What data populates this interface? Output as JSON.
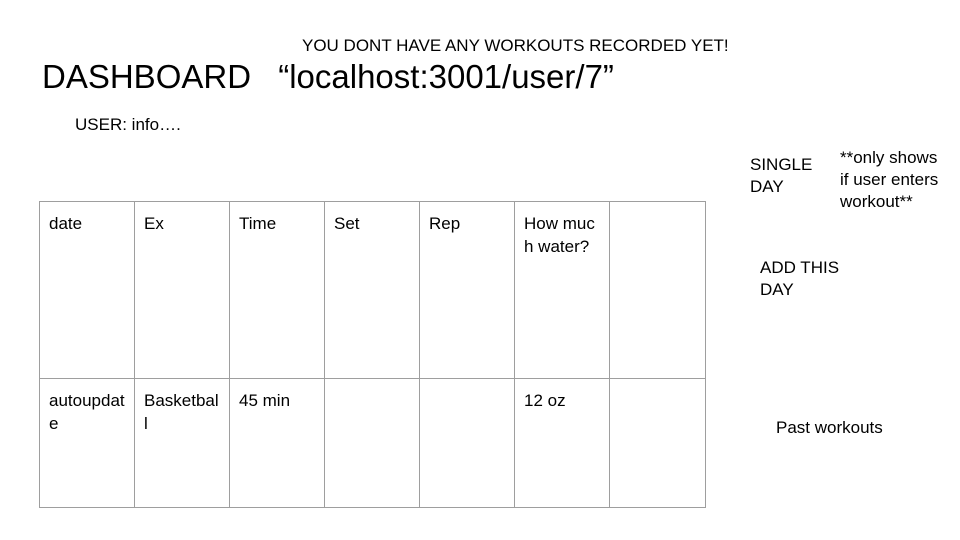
{
  "banner": "YOU DONT HAVE ANY WORKOUTS RECORDED YET!",
  "title": {
    "label": "DASHBOARD",
    "url": "“localhost:3001/user/7”"
  },
  "user_info": "USER: info….",
  "table": {
    "headers": [
      "date",
      "Ex",
      "Time",
      "Set",
      "Rep",
      "How much water?",
      ""
    ],
    "rows": [
      [
        "autoupdate",
        "Basketball",
        "45 min",
        "",
        "",
        "12 oz",
        ""
      ]
    ]
  },
  "sidebar": {
    "single_day": "SINGLE DAY",
    "note": "**only shows if user enters workout**",
    "add_this_day": "ADD THIS DAY",
    "past_workouts": "Past workouts"
  }
}
